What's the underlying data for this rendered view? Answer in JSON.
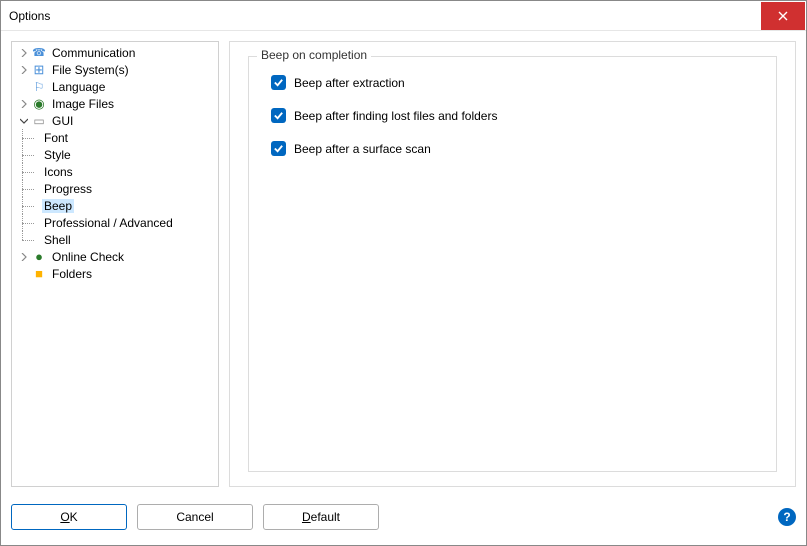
{
  "window": {
    "title": "Options"
  },
  "tree": {
    "communication": "Communication",
    "file_systems": "File System(s)",
    "language": "Language",
    "image_files": "Image Files",
    "gui": "GUI",
    "gui_children": {
      "font": "Font",
      "style": "Style",
      "icons": "Icons",
      "progress": "Progress",
      "beep": "Beep",
      "professional": "Professional / Advanced",
      "shell": "Shell"
    },
    "online_check": "Online Check",
    "folders": "Folders",
    "selected": "beep"
  },
  "panel": {
    "legend": "Beep on completion",
    "checkboxes": {
      "extraction": {
        "label": "Beep after extraction",
        "checked": true
      },
      "lost_files": {
        "label": "Beep after finding lost files and folders",
        "checked": true
      },
      "surface": {
        "label": "Beep after a surface scan",
        "checked": true
      }
    }
  },
  "buttons": {
    "ok": "OK",
    "cancel": "Cancel",
    "default": "Default"
  },
  "help": "?"
}
